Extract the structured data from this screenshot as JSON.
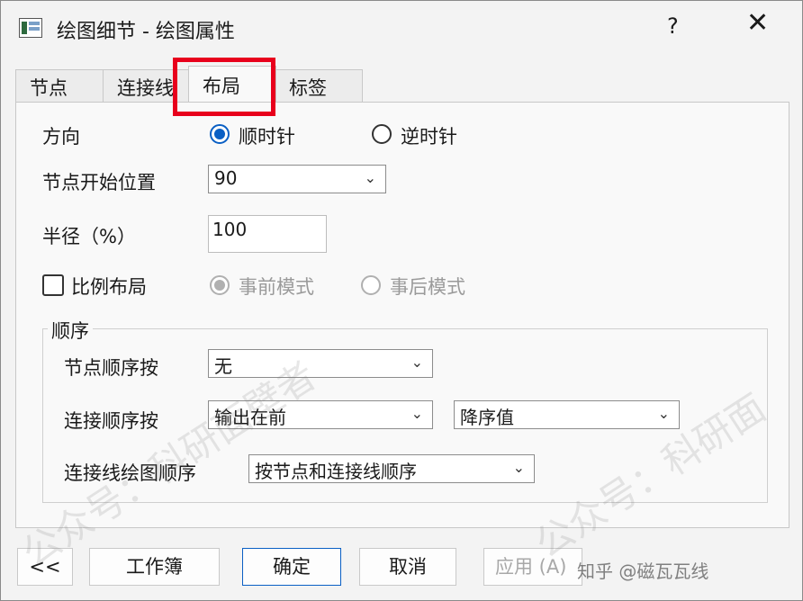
{
  "window": {
    "title": "绘图细节 - 绘图属性",
    "help": "?",
    "close": "✕"
  },
  "tabs": [
    {
      "label": "节点"
    },
    {
      "label": "连接线"
    },
    {
      "label": "布局"
    },
    {
      "label": "标签"
    }
  ],
  "active_tab": "布局",
  "layout": {
    "direction": {
      "label": "方向",
      "option_cw": "顺时针",
      "option_ccw": "逆时针",
      "selected": "顺时针"
    },
    "start_position": {
      "label": "节点开始位置",
      "value": "90"
    },
    "radius": {
      "label": "半径（%）",
      "value": "100"
    },
    "proportional": {
      "label": "比例布局",
      "checked": false,
      "option_before": "事前模式",
      "option_after": "事后模式",
      "selected": "事前模式"
    },
    "order": {
      "group_title": "顺序",
      "node_order_label": "节点顺序按",
      "node_order_value": "无",
      "connection_order_label": "连接顺序按",
      "connection_order_value": "输出在前",
      "connection_sort_value": "降序值",
      "draw_order_label": "连接线绘图顺序",
      "draw_order_value": "按节点和连接线顺序"
    }
  },
  "buttons": {
    "collapse": "<<",
    "workbook": "工作簿",
    "ok": "确定",
    "cancel": "取消",
    "apply": "应用 (A)"
  },
  "watermarks": {
    "left": "公众号：科研面壁者",
    "right": "公众号：科研面",
    "bottom": "知乎 @磁瓦瓦线"
  },
  "colors": {
    "accent": "#0a5fc4",
    "highlight": "#e8001c"
  },
  "icons": {
    "collapse": "chevrons-left-icon",
    "dropdown": "chevron-down-icon"
  }
}
